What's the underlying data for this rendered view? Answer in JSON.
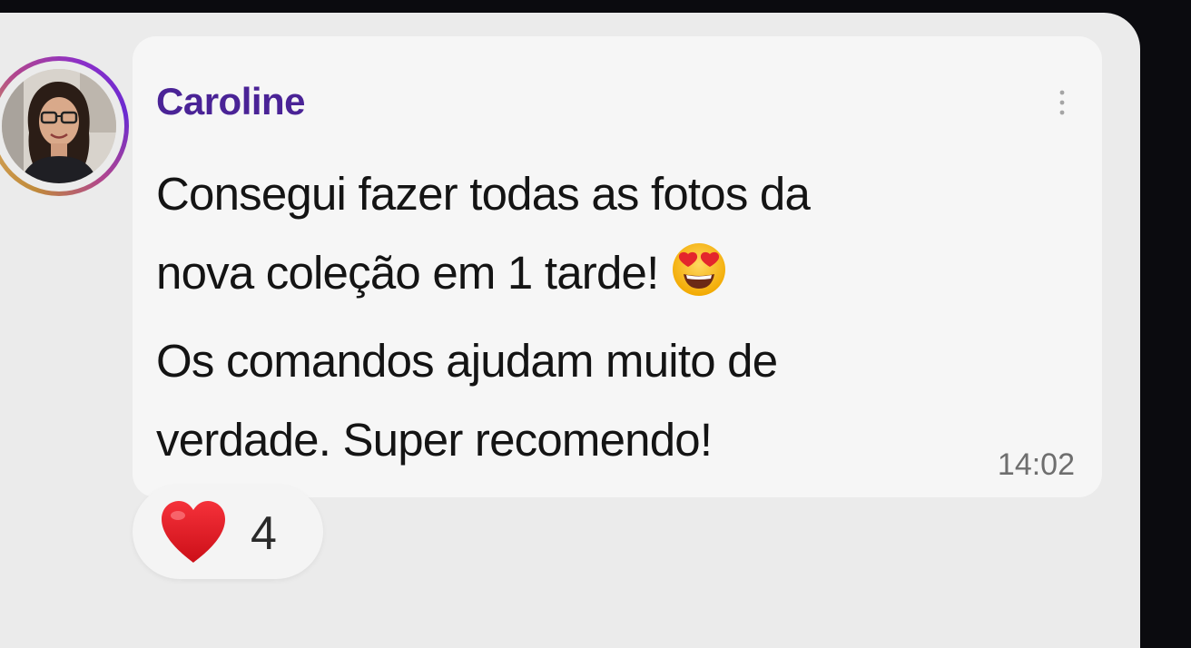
{
  "message": {
    "sender_name": "Caroline",
    "lines": [
      "Consegui fazer todas as fotos da",
      "nova coleção em 1 tarde!",
      "Os comandos ajudam muito de",
      "verdade. Super recomendo!"
    ],
    "emoji": "heart-eyes-emoji",
    "timestamp": "14:02"
  },
  "reaction": {
    "icon": "heart-icon",
    "count": "4"
  },
  "colors": {
    "sender_name": "#4a2396",
    "bubble": "#f6f6f6",
    "background": "#ebebeb",
    "heart": "#e0161e"
  }
}
